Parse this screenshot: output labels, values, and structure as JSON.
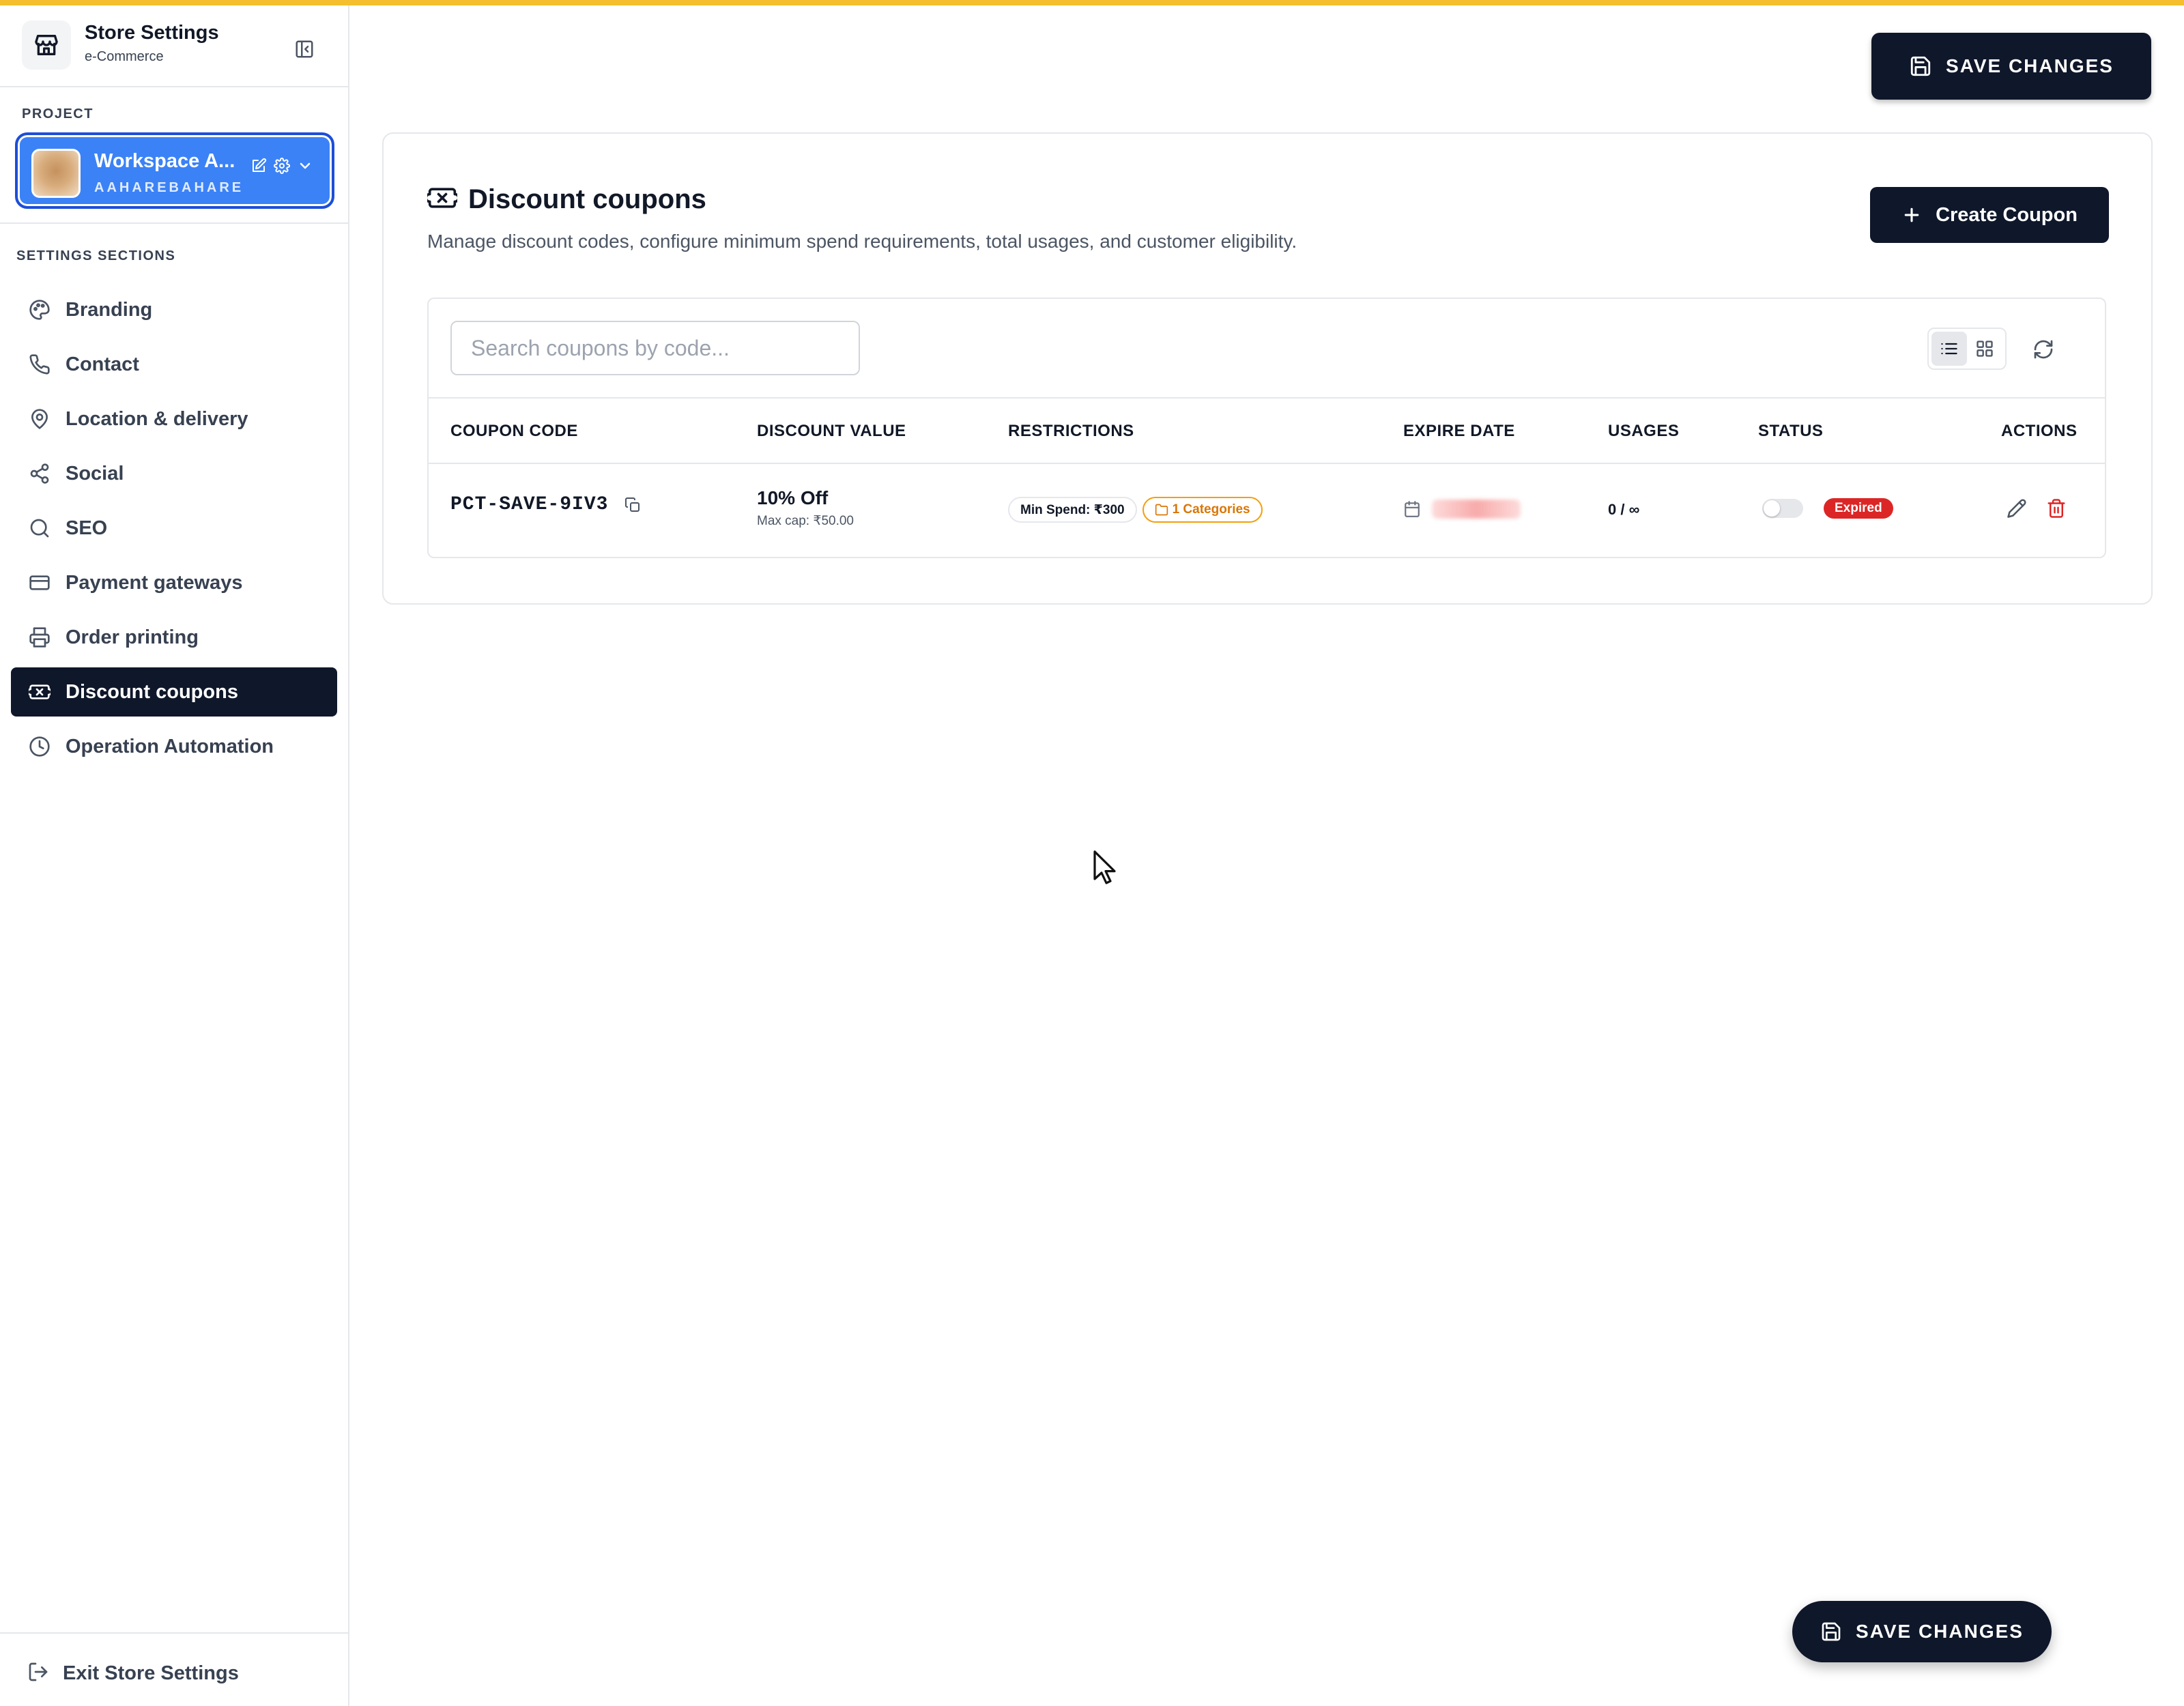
{
  "sidebar": {
    "store_title": "Store Settings",
    "store_subtitle": "e-Commerce",
    "project_label": "PROJECT",
    "project": {
      "name": "Workspace A...",
      "slug": "AAHAREBAHARE"
    },
    "sections_label": "SETTINGS SECTIONS",
    "items": [
      {
        "label": "Branding",
        "icon": "palette-icon",
        "active": false
      },
      {
        "label": "Contact",
        "icon": "phone-icon",
        "active": false
      },
      {
        "label": "Location & delivery",
        "icon": "map-pin-icon",
        "active": false
      },
      {
        "label": "Social",
        "icon": "share-icon",
        "active": false
      },
      {
        "label": "SEO",
        "icon": "search-icon",
        "active": false
      },
      {
        "label": "Payment gateways",
        "icon": "credit-card-icon",
        "active": false
      },
      {
        "label": "Order printing",
        "icon": "printer-icon",
        "active": false
      },
      {
        "label": "Discount coupons",
        "icon": "ticket-icon",
        "active": true
      },
      {
        "label": "Operation Automation",
        "icon": "clock-icon",
        "active": false
      }
    ],
    "exit_label": "Exit Store Settings"
  },
  "toolbar": {
    "save_label": "SAVE CHANGES"
  },
  "page": {
    "title": "Discount coupons",
    "description": "Manage discount codes, configure minimum spend requirements, total usages, and customer eligibility.",
    "create_label": "Create Coupon"
  },
  "search": {
    "placeholder": "Search coupons by code...",
    "value": ""
  },
  "table": {
    "columns": [
      "COUPON CODE",
      "DISCOUNT VALUE",
      "RESTRICTIONS",
      "EXPIRE DATE",
      "USAGES",
      "STATUS",
      "ACTIONS"
    ],
    "rows": [
      {
        "code": "PCT-SAVE-9IV3",
        "discount": "10% Off",
        "max_cap": "Max cap: ₹50.00",
        "min_spend": "Min Spend: ₹300",
        "categories": "1 Categories",
        "usages": "0 / ∞",
        "status": "Expired",
        "enabled": false
      }
    ]
  },
  "colors": {
    "accent": "#f5be2e",
    "primary_dark": "#0f172a",
    "project_blue": "#3b82f6",
    "danger": "#dc2626",
    "warning": "#d97706"
  }
}
